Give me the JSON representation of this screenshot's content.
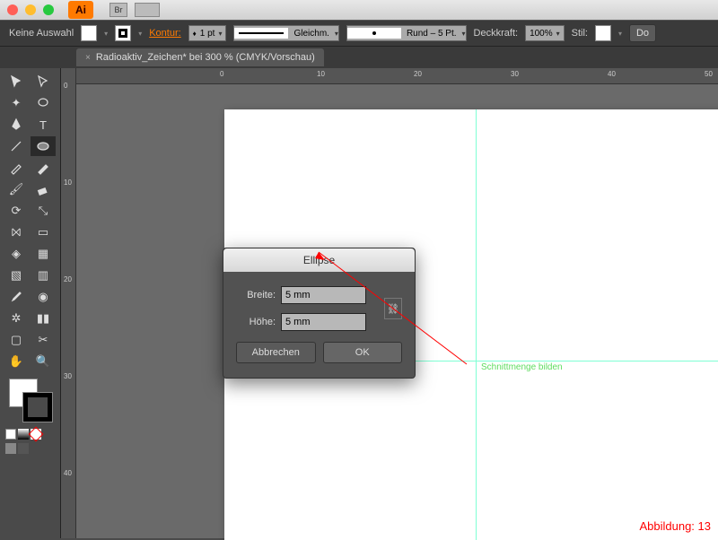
{
  "titlebar": {
    "app": "Ai"
  },
  "controlbar": {
    "selection": "Keine Auswahl",
    "kontur_label": "Kontur:",
    "stroke_weight": "1 pt",
    "profile": "Gleichm.",
    "brush": "Rund – 5 Pt.",
    "opacity_label": "Deckkraft:",
    "opacity": "100%",
    "style_label": "Stil:",
    "doc_button": "Do"
  },
  "document": {
    "tab": "Radioaktiv_Zeichen* bei 300 % (CMYK/Vorschau)"
  },
  "ruler_h": [
    "0",
    "10",
    "20",
    "30",
    "40",
    "50"
  ],
  "ruler_v": [
    "0",
    "10",
    "20",
    "30",
    "40"
  ],
  "guide": {
    "label": "Schnittmenge bilden"
  },
  "dialog": {
    "title": "Ellipse",
    "width_label": "Breite:",
    "width_value": "5 mm",
    "height_label": "Höhe:",
    "height_value": "5 mm",
    "cancel": "Abbrechen",
    "ok": "OK"
  },
  "caption": "Abbildung: 13"
}
